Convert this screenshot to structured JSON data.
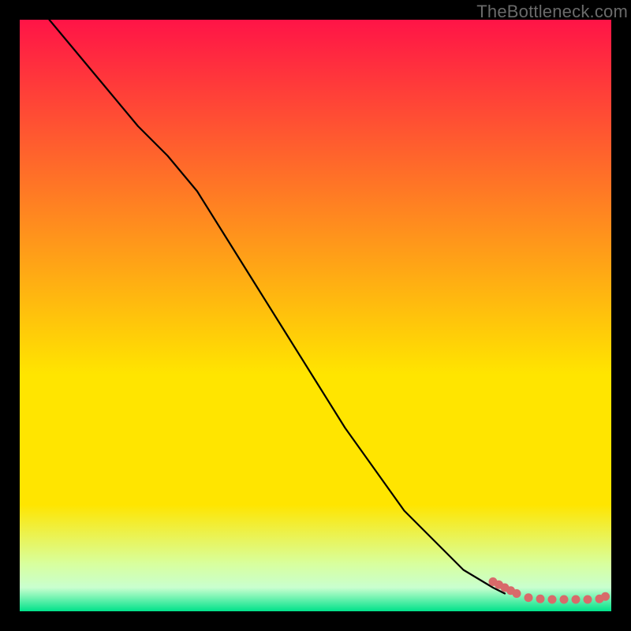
{
  "watermark": "TheBottleneck.com",
  "chart_data": {
    "type": "line",
    "title": "",
    "xlabel": "",
    "ylabel": "",
    "xlim": [
      0,
      100
    ],
    "ylim": [
      0,
      100
    ],
    "grid": false,
    "legend": false,
    "gradient": {
      "top_color": "#ff1447",
      "mid_color": "#ffe500",
      "low_color": "#d8ff9e",
      "bottom_color": "#00e28a"
    },
    "series": [
      {
        "name": "curve",
        "type": "line",
        "color": "#000000",
        "x": [
          5,
          10,
          15,
          20,
          25,
          30,
          35,
          40,
          45,
          50,
          55,
          60,
          65,
          70,
          75,
          80,
          82
        ],
        "y": [
          100,
          94,
          88,
          82,
          77,
          71,
          63,
          55,
          47,
          39,
          31,
          24,
          17,
          12,
          7,
          4,
          3
        ]
      },
      {
        "name": "dots",
        "type": "scatter",
        "color": "#d86a6a",
        "x": [
          80,
          81,
          82,
          83,
          84,
          86,
          88,
          90,
          92,
          94,
          96,
          98,
          99
        ],
        "y": [
          5.0,
          4.5,
          4.0,
          3.5,
          3.0,
          2.3,
          2.1,
          2.0,
          2.0,
          2.0,
          2.0,
          2.1,
          2.5
        ]
      }
    ]
  }
}
